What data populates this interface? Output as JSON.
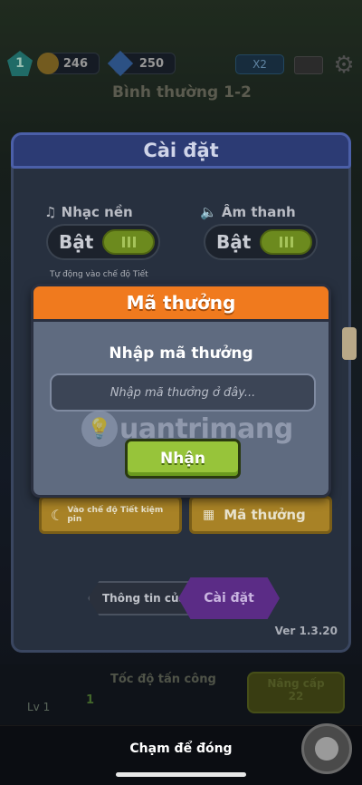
{
  "hud": {
    "level": "1",
    "coins": "246",
    "gems": "250",
    "multiplier": "X2",
    "stage": "Bình thường 1-2"
  },
  "settings": {
    "title": "Cài đặt",
    "music_label": "Nhạc nền",
    "music_state": "Bật",
    "sound_label": "Âm thanh",
    "sound_state": "Bật",
    "auto_text": "Tự động vào chế độ Tiết",
    "battery_saver_label": "Vào chế độ Tiết kiệm pin",
    "reward_code_label": "Mã thưởng",
    "tab_info": "Thông tin của tôi",
    "tab_settings": "Cài đặt",
    "version": "Ver 1.3.20"
  },
  "dialog": {
    "title": "Mã thưởng",
    "prompt": "Nhập mã thưởng",
    "input_placeholder": "Nhập mã thưởng ở đây...",
    "claim_label": "Nhận"
  },
  "bottom": {
    "attack_speed_label": "Tốc độ tấn công",
    "attack_speed_value": "1",
    "player_level": "Lv 1",
    "upgrade_label": "Nâng cấp",
    "upgrade_cost": "22"
  },
  "watermark": "uantrimang",
  "close_hint": "Chạm để đóng",
  "colors": {
    "dialog_header": "#f07a1e",
    "claim_button": "#97c43a",
    "settings_header": "#2c3b74",
    "active_tab": "#5b2c86"
  }
}
